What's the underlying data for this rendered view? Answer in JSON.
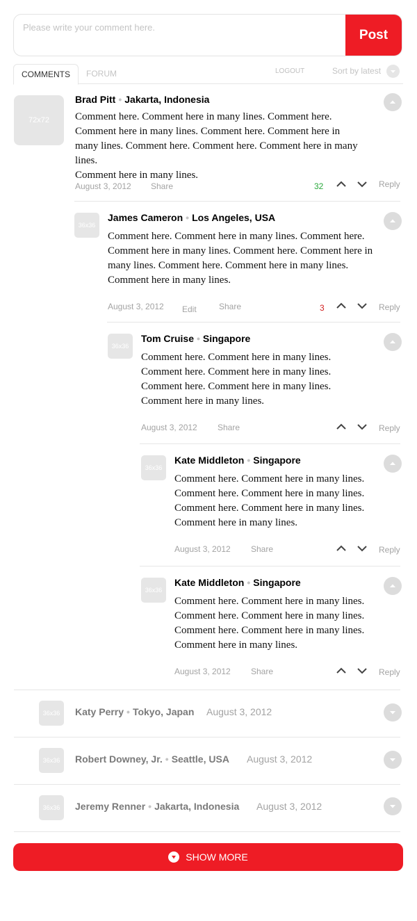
{
  "composer": {
    "placeholder": "Please write your comment here.",
    "post_label": "Post"
  },
  "tabs": {
    "comments": "COMMENTS",
    "forum": "FORUM",
    "logout": "LOGOUT",
    "sort": "Sort by latest"
  },
  "comments": [
    {
      "avatar": "72x72",
      "name": "Brad Pitt",
      "location": "Jakarta, Indonesia",
      "lines": [
        "Comment here. Comment here in many lines. Comment here.",
        "Comment here in many lines. Comment here. Comment here in",
        "many lines. Comment here. Comment here. Comment here in many lines.",
        "Comment here in many lines."
      ],
      "date": "August 3, 2012",
      "share": "Share",
      "votes": "32",
      "reply": "Reply"
    },
    {
      "avatar": "36x36",
      "name": "James Cameron",
      "location": "Los Angeles, USA",
      "lines": [
        "Comment here. Comment here in many lines. Comment here.",
        "Comment here in many lines. Comment here. Comment here in",
        "many lines. Comment here. Comment here in many lines.",
        "Comment here in many lines."
      ],
      "date": "August 3, 2012",
      "edit": "Edit",
      "share": "Share",
      "votes": "3",
      "reply": "Reply"
    },
    {
      "avatar": "36x36",
      "name": "Tom Cruise",
      "location": "Singapore",
      "lines": [
        "Comment here. Comment here in many lines.",
        "Comment here. Comment here in many lines.",
        "Comment here. Comment here in many lines.",
        "Comment here in many lines."
      ],
      "date": "August 3, 2012",
      "share": "Share",
      "reply": "Reply"
    },
    {
      "avatar": "36x36",
      "name": "Kate Middleton",
      "location": "Singapore",
      "lines": [
        "Comment here. Comment here in many lines.",
        "Comment here. Comment here in many lines.",
        "Comment here. Comment here in many lines.",
        "Comment here in many lines."
      ],
      "date": "August 3, 2012",
      "share": "Share",
      "reply": "Reply"
    },
    {
      "avatar": "36x36",
      "name": "Kate Middleton",
      "location": "Singapore",
      "lines": [
        "Comment here. Comment here in many lines.",
        "Comment here. Comment here in many lines.",
        "Comment here. Comment here in many lines.",
        "Comment here in many lines."
      ],
      "date": "August 3, 2012",
      "share": "Share",
      "reply": "Reply"
    }
  ],
  "collapsed": [
    {
      "avatar": "36x36",
      "name": "Katy Perry",
      "location": "Tokyo, Japan",
      "date": "August 3, 2012"
    },
    {
      "avatar": "36x36",
      "name": "Robert Downey, Jr.",
      "location": "Seattle, USA",
      "date": "August 3, 2012"
    },
    {
      "avatar": "36x36",
      "name": "Jeremy Renner",
      "location": "Jakarta, Indonesia",
      "date": "August 3, 2012"
    }
  ],
  "show_more": "SHOW MORE",
  "colors": {
    "accent": "#ee1c25",
    "positive": "#2aa83c",
    "negative": "#d22121",
    "placeholder": "#e6e6e6"
  }
}
